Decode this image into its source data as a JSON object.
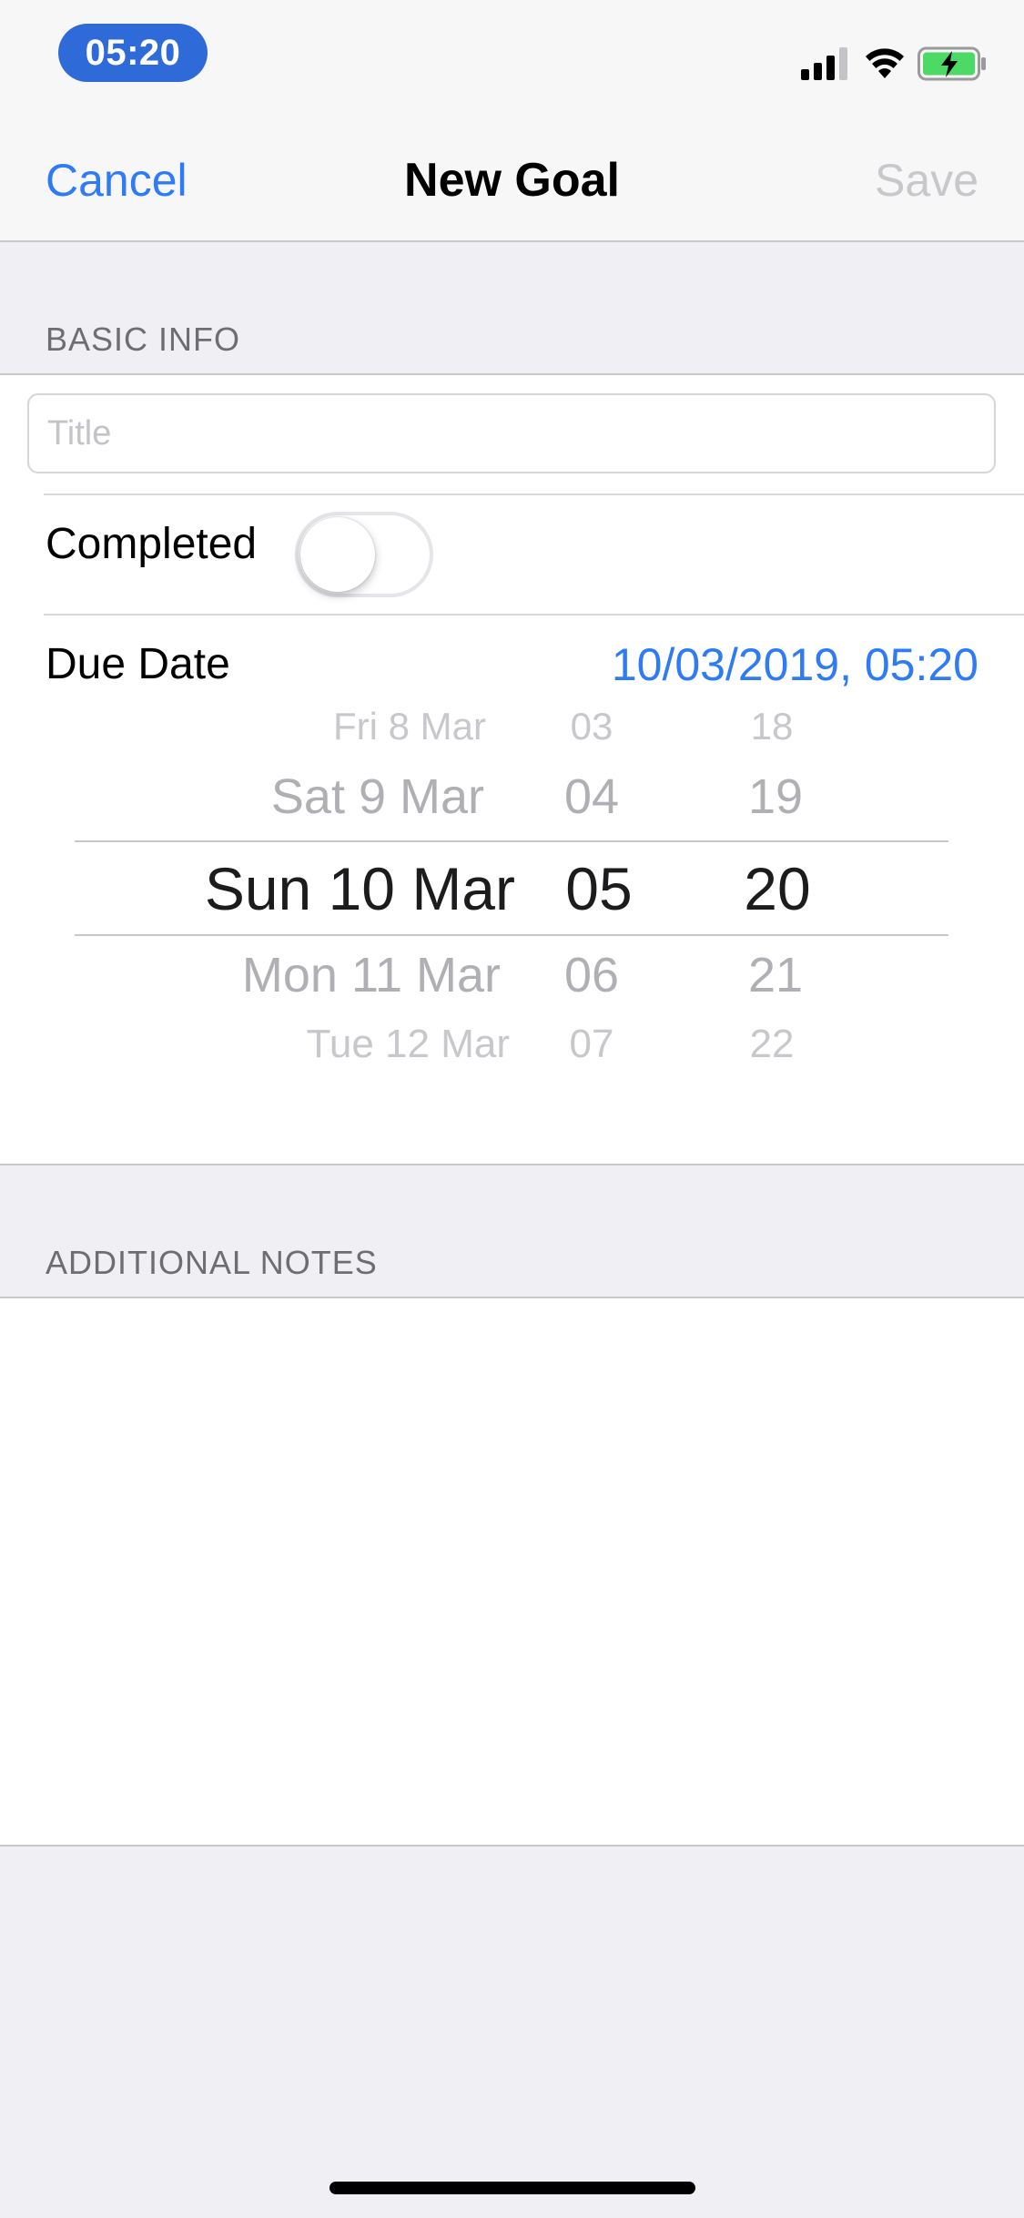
{
  "status_bar": {
    "time": "05:20"
  },
  "nav": {
    "cancel_label": "Cancel",
    "title": "New Goal",
    "save_label": "Save"
  },
  "basic_info": {
    "header": "BASIC INFO",
    "title_placeholder": "Title",
    "title_value": "",
    "completed_label": "Completed",
    "completed_on": false,
    "due_date_label": "Due Date",
    "due_date_value": "10/03/2019, 05:20"
  },
  "picker": {
    "dates": [
      "Fri 8 Mar",
      "Sat 9 Mar",
      "Sun 10 Mar",
      "Mon 11 Mar",
      "Tue 12 Mar"
    ],
    "hours": [
      "03",
      "04",
      "05",
      "06",
      "07"
    ],
    "minutes": [
      "18",
      "19",
      "20",
      "21",
      "22"
    ],
    "selected_index": 2
  },
  "notes": {
    "header": "ADDITIONAL NOTES",
    "value": ""
  },
  "colors": {
    "accent": "#2f7bf5",
    "time_pill": "#2f6bd8",
    "disabled": "#c7c7cc",
    "group_background": "#efeff4",
    "battery": "#4cd964"
  },
  "icons": [
    "cellular-signal-icon",
    "wifi-icon",
    "battery-charging-icon"
  ]
}
